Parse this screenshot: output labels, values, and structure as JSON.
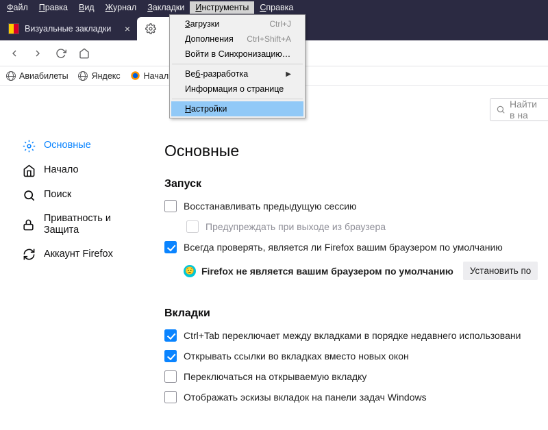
{
  "menubar": [
    "Файл",
    "Правка",
    "Вид",
    "Журнал",
    "Закладки",
    "Инструменты",
    "Справка"
  ],
  "menubar_u": [
    "Ф",
    "П",
    "В",
    "Ж",
    "З",
    "И",
    "С"
  ],
  "menubar_active_index": 5,
  "tabs": {
    "items": [
      {
        "title": "Визуальные закладки",
        "active": false,
        "fav": "vb"
      },
      {
        "title": "",
        "active": true,
        "fav": "gear"
      }
    ],
    "plus": "+"
  },
  "bookmarks": [
    {
      "label": "Авиабилеты",
      "icon": "globe"
    },
    {
      "label": "Яндекс",
      "icon": "globe"
    },
    {
      "label": "Началь",
      "icon": "firefox"
    }
  ],
  "dropdown": {
    "items": [
      {
        "label": "Загрузки",
        "u": "З",
        "shortcut": "Ctrl+J"
      },
      {
        "label": "Дополнения",
        "u": "",
        "shortcut": "Ctrl+Shift+A"
      },
      {
        "label": "Войти в Синхронизацию…",
        "u": ""
      },
      {
        "sep": true
      },
      {
        "label": "Веб-разработка",
        "u": "б",
        "sub": true
      },
      {
        "label": "Информация о странице",
        "u": ""
      },
      {
        "sep": true
      },
      {
        "label": "Настройки",
        "u": "Н",
        "highlight": true
      }
    ]
  },
  "search": {
    "placeholder": "Найти в на"
  },
  "sidebar": {
    "items": [
      {
        "key": "general",
        "label": "Основные",
        "active": true
      },
      {
        "key": "home",
        "label": "Начало"
      },
      {
        "key": "search",
        "label": "Поиск"
      },
      {
        "key": "privacy",
        "label": "Приватность и Защита"
      },
      {
        "key": "account",
        "label": "Аккаунт Firefox"
      }
    ]
  },
  "page": {
    "title": "Основные",
    "startup": {
      "heading": "Запуск",
      "restore": "Восстанавливать предыдущую сессию",
      "warn": "Предупреждать при выходе из браузера",
      "always_check": "Всегда проверять, является ли Firefox вашим браузером по умолчанию",
      "status": "Firefox не является вашим браузером по умолчанию",
      "set_default": "Установить по"
    },
    "tabs_section": {
      "heading": "Вкладки",
      "ctrl_tab": "Ctrl+Tab переключает между вкладками в порядке недавнего использовани",
      "open_links": "Открывать ссылки во вкладках вместо новых окон",
      "switch_to": "Переключаться на открываемую вкладку",
      "thumbnails": "Отображать эскизы вкладок на панели задач Windows"
    }
  }
}
